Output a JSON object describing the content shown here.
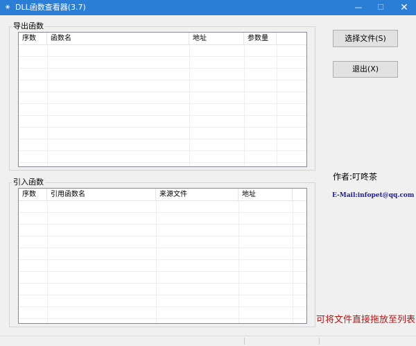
{
  "window": {
    "title": "DLL函数查看器(3.7)"
  },
  "titlebar": {
    "minimize": "—",
    "maximize": "☐",
    "close": "✕",
    "icon": "⚹"
  },
  "export_group": {
    "label": "导出函数",
    "columns": [
      "序数",
      "函数名",
      "地址",
      "参数量"
    ]
  },
  "import_group": {
    "label": "引入函数",
    "columns": [
      "序数",
      "引用函数名",
      "来源文件",
      "地址"
    ]
  },
  "buttons": {
    "select_file": "选择文件(S)",
    "exit": "退出(X)"
  },
  "info": {
    "author": "作者:叮咚茶",
    "email": "E-Mail:infopet@qq.com",
    "drop_hint": "可将文件直接拖放至列表"
  }
}
